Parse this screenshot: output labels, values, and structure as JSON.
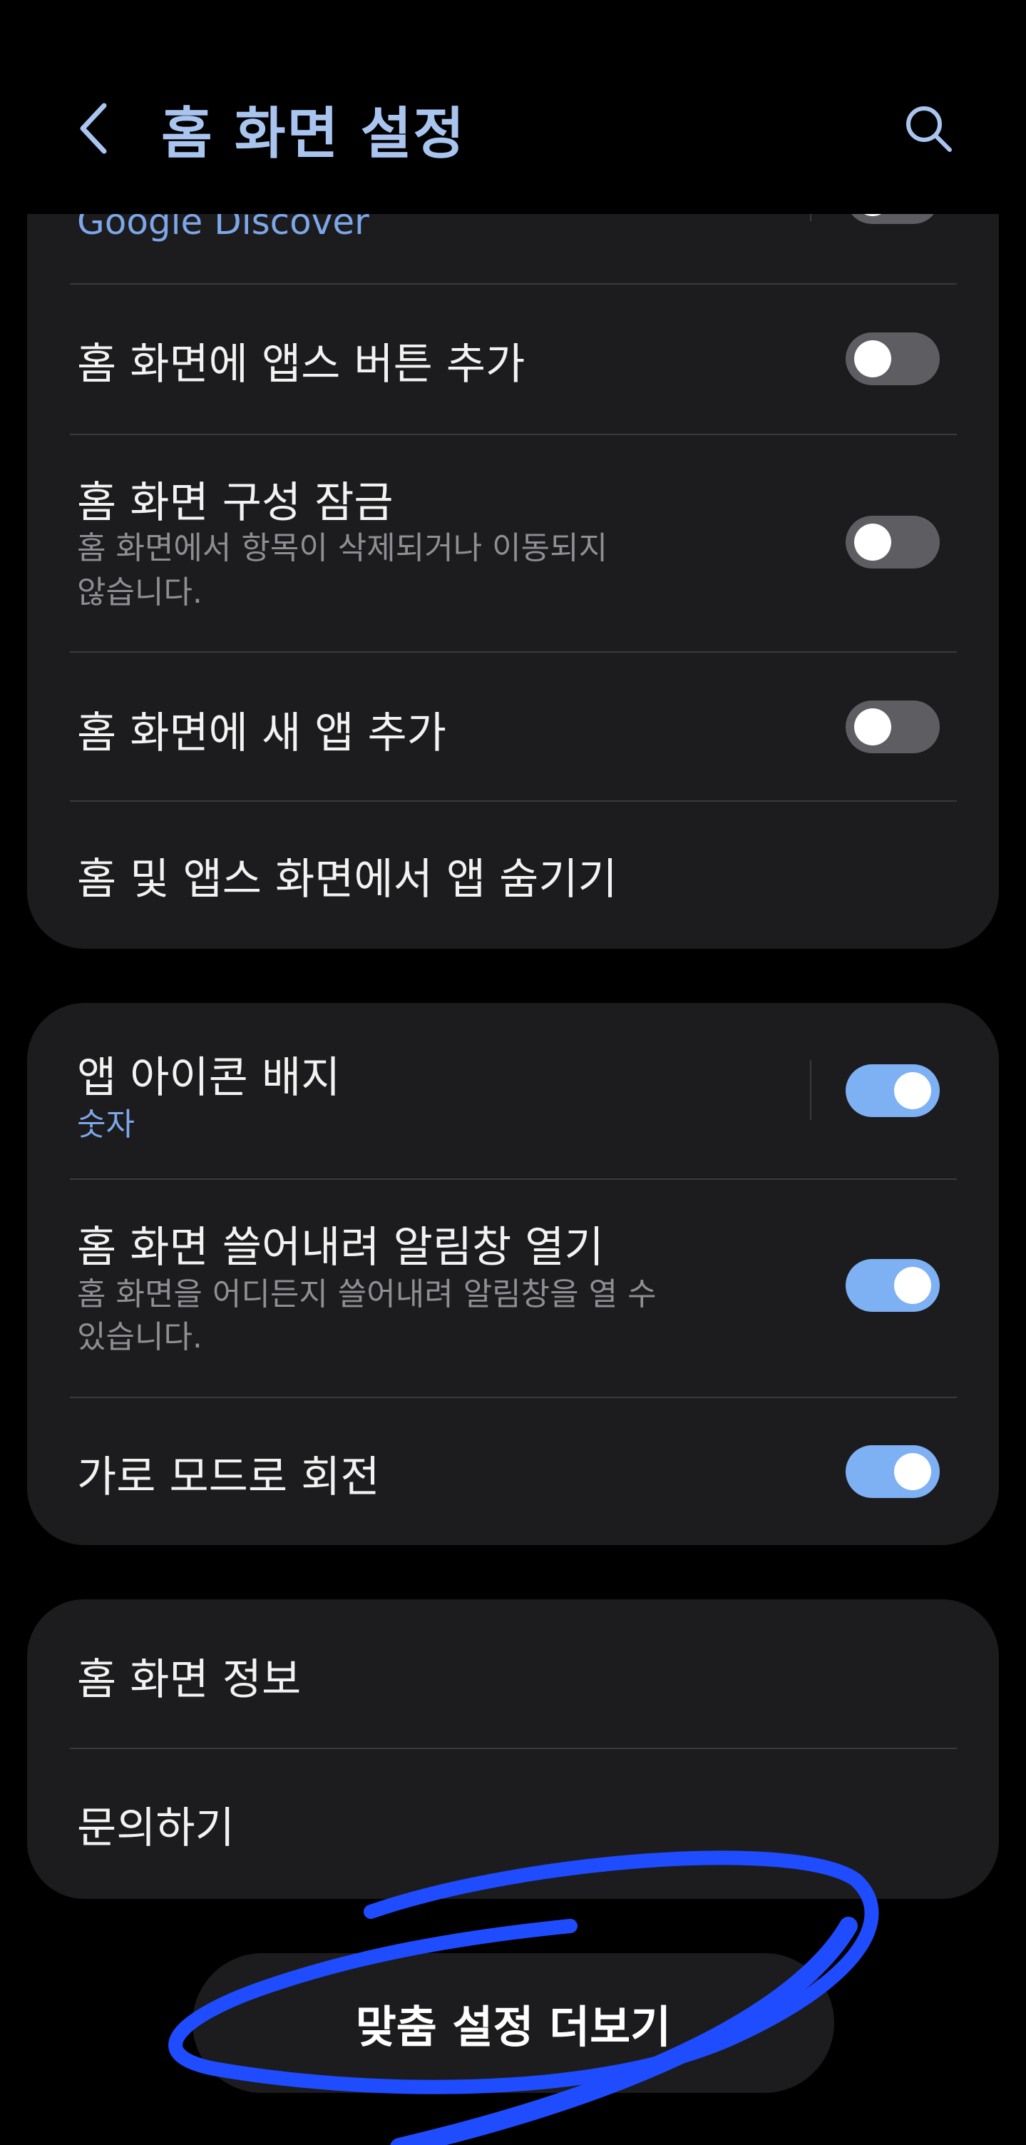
{
  "header": {
    "title": "홈 화면 설정"
  },
  "card1": {
    "partial_item": "Google Discover",
    "items": [
      {
        "title": "홈 화면에 앱스 버튼 추가",
        "toggle": "off"
      },
      {
        "title": "홈 화면 구성 잠금",
        "subtitle_line1": "홈 화면에서 항목이 삭제되거나 이동되지",
        "subtitle_line2": "않습니다.",
        "toggle": "off"
      },
      {
        "title": "홈 화면에 새 앱 추가",
        "toggle": "off"
      },
      {
        "title": "홈 및 앱스 화면에서 앱 숨기기"
      }
    ]
  },
  "card2": {
    "items": [
      {
        "title": "앱 아이콘 배지",
        "value": "숫자",
        "toggle": "on"
      },
      {
        "title": "홈 화면 쓸어내려 알림창 열기",
        "subtitle_line1": "홈 화면을 어디든지 쓸어내려 알림창을 열 수",
        "subtitle_line2": "있습니다.",
        "toggle": "on"
      },
      {
        "title": "가로 모드로 회전",
        "toggle": "on"
      }
    ]
  },
  "card3": {
    "items": [
      {
        "title": "홈 화면 정보"
      },
      {
        "title": "문의하기"
      }
    ]
  },
  "footer": {
    "more_button": "맞춤 설정 더보기"
  },
  "colors": {
    "accent": "#7eb0f4",
    "title": "#a9c5ef",
    "card": "#1c1c1e",
    "annotation": "#1f4cff"
  }
}
